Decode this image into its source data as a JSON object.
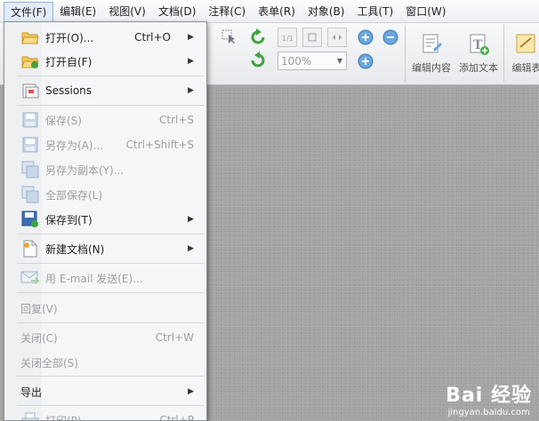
{
  "menubar": [
    "文件(F)",
    "编辑(E)",
    "视图(V)",
    "文档(D)",
    "注释(C)",
    "表单(R)",
    "对象(B)",
    "工具(T)",
    "窗口(W)"
  ],
  "toolbar": {
    "zoom_value": "100%",
    "edit_content": "编辑内容",
    "add_text": "添加文本",
    "edit_table": "编辑表"
  },
  "file_menu": {
    "open": {
      "label": "打开(O)...",
      "shortcut": "Ctrl+O"
    },
    "open_from": {
      "label": "打开自(F)"
    },
    "sessions": {
      "label": "Sessions"
    },
    "save": {
      "label": "保存(S)",
      "shortcut": "Ctrl+S"
    },
    "save_as": {
      "label": "另存为(A)...",
      "shortcut": "Ctrl+Shift+S"
    },
    "save_copy": {
      "label": "另存为副本(Y)..."
    },
    "save_all": {
      "label": "全部保存(L)"
    },
    "save_to": {
      "label": "保存到(T)"
    },
    "new_doc": {
      "label": "新建文档(N)"
    },
    "email": {
      "label": "用 E-mail 发送(E)..."
    },
    "revert": {
      "label": "回复(V)"
    },
    "close": {
      "label": "关闭(C)",
      "shortcut": "Ctrl+W"
    },
    "close_all": {
      "label": "关闭全部(S)"
    },
    "export": {
      "label": "导出"
    },
    "print": {
      "label": "打印(P)",
      "shortcut": "Ctrl+P"
    }
  },
  "watermark": {
    "logo": "Bai 经验",
    "url": "jingyan.baidu.com"
  }
}
